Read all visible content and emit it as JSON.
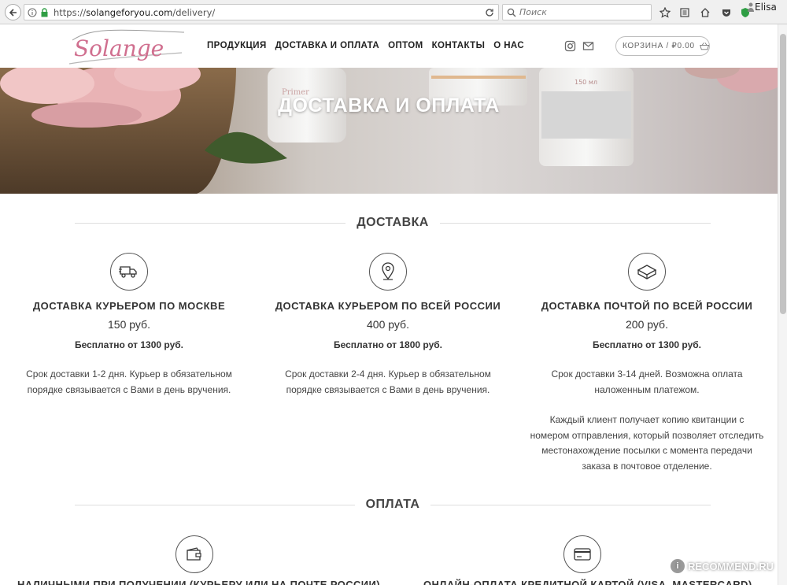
{
  "browser": {
    "url_scheme": "https://",
    "url_host": "solangeforyou.com",
    "url_path": "/delivery/",
    "search_placeholder": "Поиск",
    "profile_name": "Elisa"
  },
  "site": {
    "logo_text": "Solange",
    "nav": [
      "ПРОДУКЦИЯ",
      "ДОСТАВКА И ОПЛАТА",
      "ОПТОМ",
      "КОНТАКТЫ",
      "О НАС"
    ],
    "cart_label": "КОРЗИНА / ₽0.00"
  },
  "hero": {
    "title": "ДОСТАВКА И ОПЛАТА",
    "label_primer": "Primer",
    "label_volume": "150 мл"
  },
  "delivery": {
    "heading": "ДОСТАВКА",
    "options": [
      {
        "icon": "delivery-truck-icon",
        "title": "ДОСТАВКА КУРЬЕРОМ ПО МОСКВЕ",
        "price": "150 руб.",
        "free": "Бесплатно от 1300 руб.",
        "desc_line1": "Срок доставки 1-2 дня. Курьер в обязательном",
        "desc_line2": "порядке связывается с Вами в день вручения."
      },
      {
        "icon": "map-pin-icon",
        "title": "ДОСТАВКА КУРЬЕРОМ ПО ВСЕЙ РОССИИ",
        "price": "400 руб.",
        "free": "Бесплатно от 1800 руб.",
        "desc_line1": "Срок доставки 2-4 дня. Курьер в обязательном",
        "desc_line2": "порядке связывается с Вами в день вручения."
      },
      {
        "icon": "parcel-box-icon",
        "title": "ДОСТАВКА ПОЧТОЙ ПО ВСЕЙ РОССИИ",
        "price": "200 руб.",
        "free": "Бесплатно от 1300 руб.",
        "desc_line1": "Срок доставки 3-14 дней. Возможна оплата",
        "desc_line2": "наложенным платежом.",
        "extra_lines": [
          "Каждый клиент получает копию квитанции с",
          "номером отправления, который позволяет отследить",
          "местонахождение посылки с момента передачи",
          "заказа в почтовое отделение."
        ]
      }
    ]
  },
  "payment": {
    "heading": "ОПЛАТА",
    "options": [
      {
        "icon": "wallet-icon",
        "title": "НАЛИЧНЫМИ ПРИ ПОЛУЧЕНИИ (КУРЬЕРУ ИЛИ НА ПОЧТЕ РОССИИ)"
      },
      {
        "icon": "credit-card-icon",
        "title": "ОНЛАЙН-ОПЛАТА КРЕДИТНОЙ КАРТОЙ (VISA, MASTERCARD)"
      }
    ]
  },
  "watermark": {
    "text": "RECOMMEND.RU",
    "badge": "i"
  }
}
